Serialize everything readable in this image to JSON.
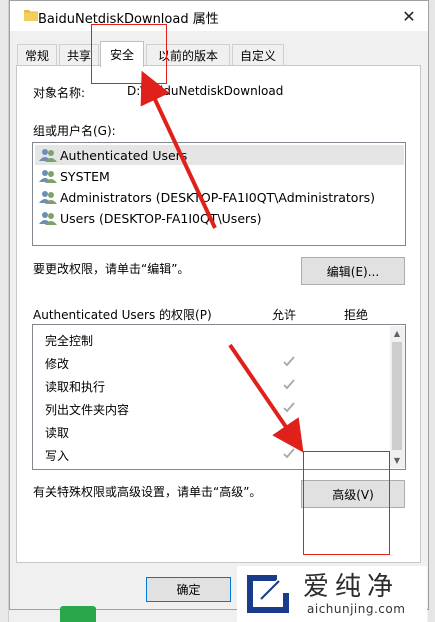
{
  "window": {
    "title": "BaiduNetdiskDownload 属性",
    "close_glyph": "✕"
  },
  "tabs": [
    {
      "label": "常规"
    },
    {
      "label": "共享"
    },
    {
      "label": "安全",
      "active": true
    },
    {
      "label": "以前的版本"
    },
    {
      "label": "自定义"
    }
  ],
  "security": {
    "object_name_label": "对象名称:",
    "object_name_value": "D:\\BaiduNetdiskDownload",
    "group_label": "组或用户名(G):",
    "users": [
      {
        "name": "Authenticated Users",
        "selected": true
      },
      {
        "name": "SYSTEM"
      },
      {
        "name": "Administrators (DESKTOP-FA1I0QT\\Administrators)"
      },
      {
        "name": "Users (DESKTOP-FA1I0QT\\Users)"
      }
    ],
    "change_hint": "要更改权限，请单击“编辑”。",
    "edit_button": "编辑(E)...",
    "perm_header": "Authenticated Users 的权限(P)",
    "allow_header": "允许",
    "deny_header": "拒绝",
    "permissions": [
      {
        "name": "完全控制",
        "allow": false
      },
      {
        "name": "修改",
        "allow": true
      },
      {
        "name": "读取和执行",
        "allow": true
      },
      {
        "name": "列出文件夹内容",
        "allow": true
      },
      {
        "name": "读取",
        "allow": true
      },
      {
        "name": "写入",
        "allow": true
      }
    ],
    "advanced_hint": "有关特殊权限或高级设置，请单击“高级”。",
    "advanced_button": "高级(V)"
  },
  "footer": {
    "ok_button": "确定"
  },
  "watermark": {
    "brand": "爱纯净",
    "url": "aichunjing.com"
  },
  "colors": {
    "annotation_red": "#e0201a",
    "selection_gray": "#e5e5e5",
    "window_bg": "#f0f0f0"
  }
}
